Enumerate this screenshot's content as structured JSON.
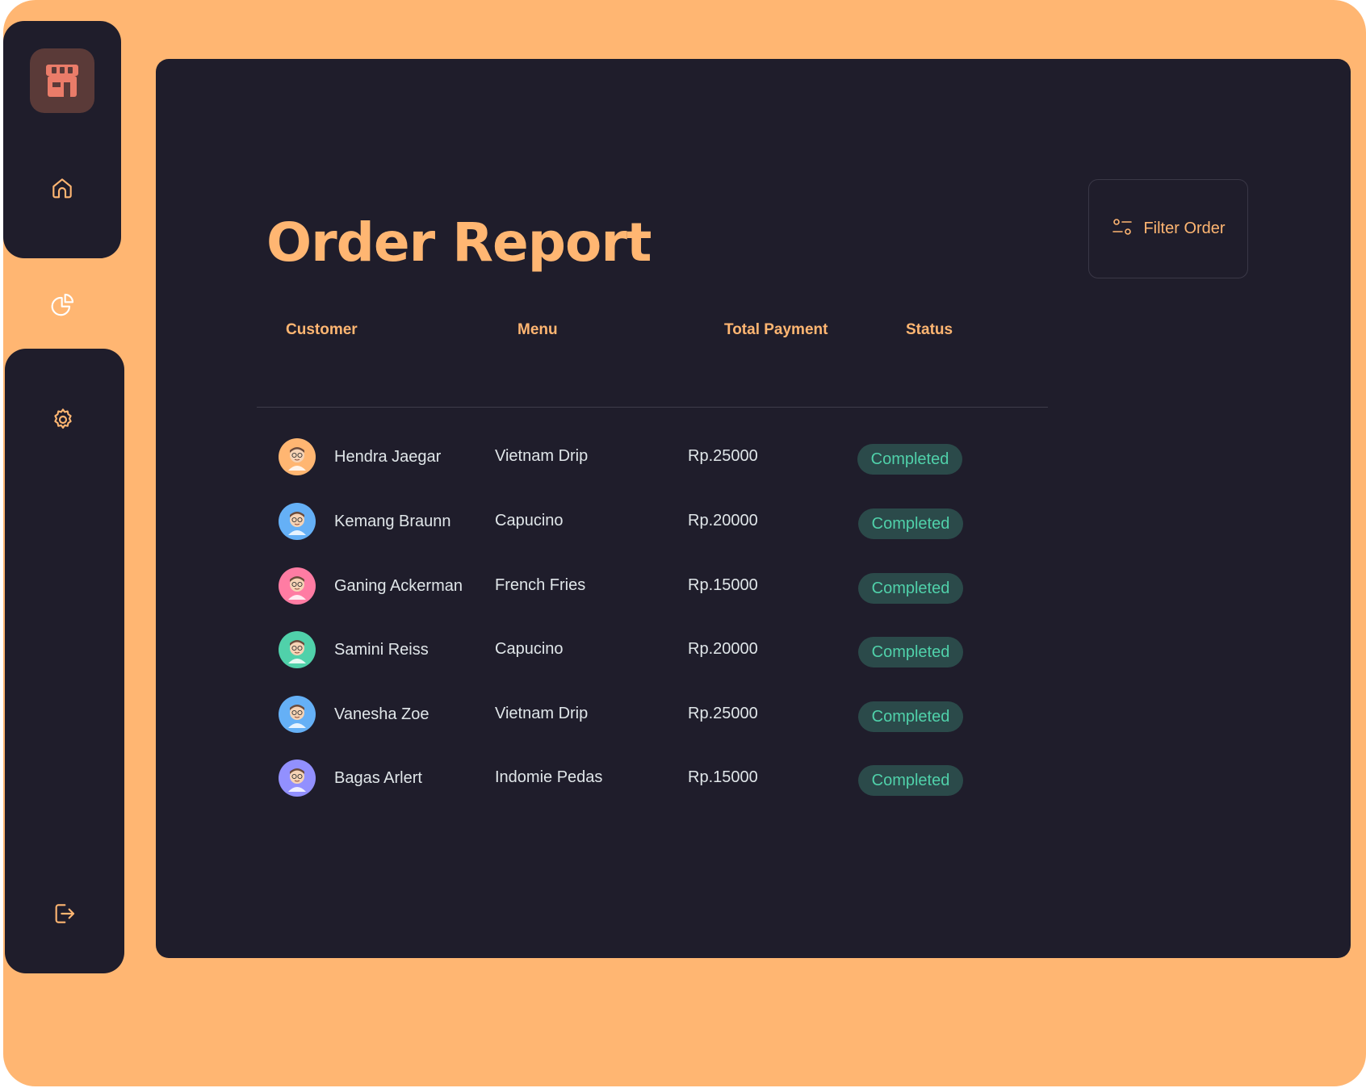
{
  "app": {
    "logo_icon": "store-icon",
    "accent_color": "#FFB672",
    "background_color": "#1F1D2B",
    "status_color": "#50D1AA"
  },
  "sidebar": {
    "items": [
      {
        "name": "home",
        "icon": "home-icon",
        "active": false
      },
      {
        "name": "reports",
        "icon": "pie-chart-icon",
        "active": true
      },
      {
        "name": "settings",
        "icon": "gear-icon",
        "active": false
      }
    ],
    "logout_icon": "logout-icon"
  },
  "page": {
    "title": "Order Report",
    "filter_label": "Filter Order",
    "filter_icon": "sliders-icon"
  },
  "table": {
    "headers": {
      "customer": "Customer",
      "menu": "Menu",
      "total": "Total Payment",
      "status": "Status"
    },
    "rows": [
      {
        "customer": "Hendra Jaegar",
        "menu": "Vietnam Drip",
        "total": "Rp.25000",
        "status": "Completed",
        "avatar_color": "#FFB672"
      },
      {
        "customer": "Kemang Braunn",
        "menu": "Capucino",
        "total": "Rp.20000",
        "status": "Completed",
        "avatar_color": "#65B0F6"
      },
      {
        "customer": "Ganing Ackerman",
        "menu": "French Fries",
        "total": "Rp.15000",
        "status": "Completed",
        "avatar_color": "#FF7CA3"
      },
      {
        "customer": "Samini Reiss",
        "menu": "Capucino",
        "total": "Rp.20000",
        "status": "Completed",
        "avatar_color": "#50D1AA"
      },
      {
        "customer": "Vanesha Zoe",
        "menu": "Vietnam Drip",
        "total": "Rp.25000",
        "status": "Completed",
        "avatar_color": "#65B0F6"
      },
      {
        "customer": "Bagas Arlert",
        "menu": "Indomie Pedas",
        "total": "Rp.15000",
        "status": "Completed",
        "avatar_color": "#9290FE"
      }
    ]
  }
}
